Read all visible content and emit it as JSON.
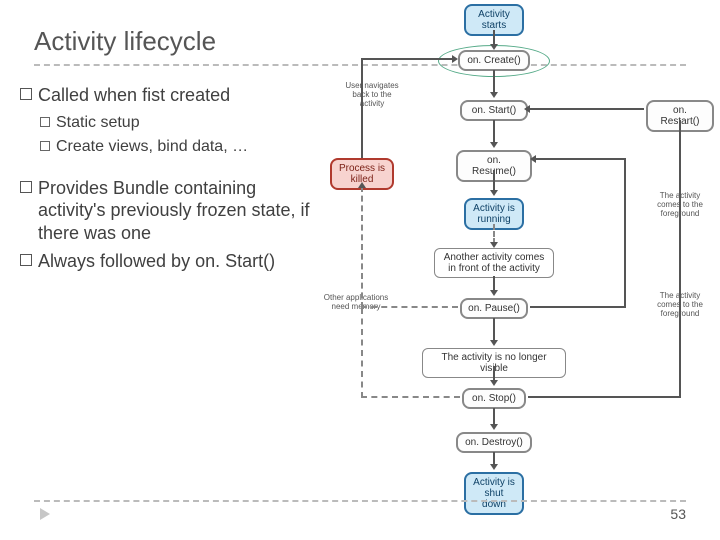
{
  "title": "Activity lifecycle",
  "bullets": {
    "b1": "Called when fist created",
    "b1a": "Static setup",
    "b1b": "Create views, bind data, …",
    "b2": "Provides Bundle containing activity's previously frozen state, if there was one",
    "b3": "Always followed by on. Start()"
  },
  "diagram": {
    "activity_starts": "Activity\nstarts",
    "onCreate": "on. Create()",
    "onStart": "on. Start()",
    "onResume": "on. Resume()",
    "activity_running": "Activity is\nrunning",
    "onRestart": "on. Restart()",
    "another_activity": "Another activity comes\nin front of the activity",
    "onPause": "on. Pause()",
    "no_longer_visible": "The activity is no longer visible",
    "onStop": "on. Stop()",
    "onDestroy": "on. Destroy()",
    "shut_down": "Activity is\nshut down",
    "process_killed": "Process is\nkilled",
    "nav_back": "User navigates\nback to the\nactivity",
    "other_apps": "Other applications\nneed memory",
    "activity_foreground": "The activity\ncomes to the\nforeground",
    "activity_foreground2": "The activity\ncomes to the\nforeground"
  },
  "page_number": "53"
}
